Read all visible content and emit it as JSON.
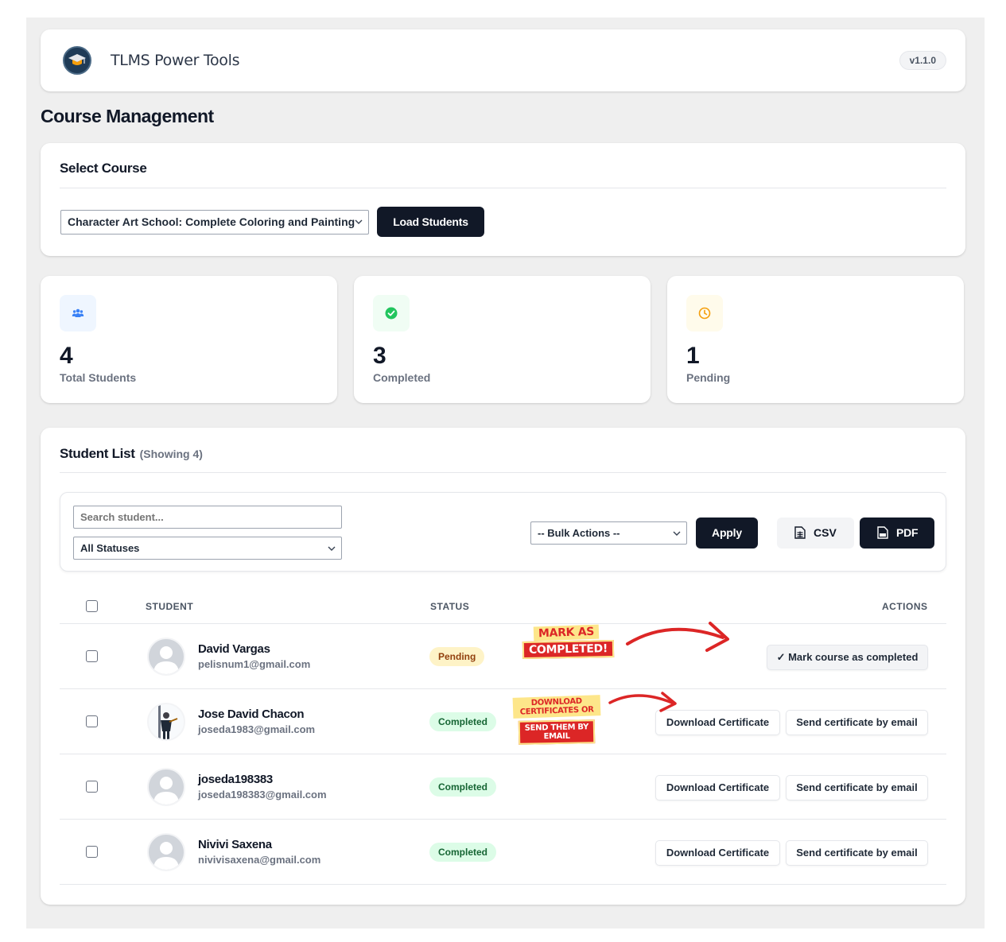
{
  "app": {
    "title": "TLMS Power Tools",
    "version": "v1.1.0"
  },
  "page": {
    "title": "Course Management"
  },
  "select_course": {
    "title": "Select Course",
    "selected_course": "Character Art School: Complete Coloring and Painting",
    "load_button": "Load Students"
  },
  "stats": [
    {
      "value": "4",
      "label": "Total Students",
      "icon": "users-icon",
      "color": "#3b82f6"
    },
    {
      "value": "3",
      "label": "Completed",
      "icon": "check-circle-icon",
      "color": "#22c55e"
    },
    {
      "value": "1",
      "label": "Pending",
      "icon": "clock-icon",
      "color": "#f59e0b"
    }
  ],
  "student_list": {
    "title": "Student List",
    "showing": "(Showing 4)",
    "search_placeholder": "Search student...",
    "status_filter": "All Statuses",
    "bulk_actions": "-- Bulk Actions --",
    "apply_button": "Apply",
    "csv_button": "CSV",
    "pdf_button": "PDF",
    "columns": {
      "student": "STUDENT",
      "status": "STATUS",
      "actions": "ACTIONS"
    },
    "rows": [
      {
        "name": "David Vargas",
        "email": "pelisnum1@gmail.com",
        "status": "Pending",
        "actions": [
          "✓ Mark course as completed"
        ]
      },
      {
        "name": "Jose David Chacon",
        "email": "joseda1983@gmail.com",
        "status": "Completed",
        "actions": [
          "Download Certificate",
          "Send certificate by email"
        ]
      },
      {
        "name": "joseda198383",
        "email": "joseda198383@gmail.com",
        "status": "Completed",
        "actions": [
          "Download Certificate",
          "Send certificate by email"
        ]
      },
      {
        "name": "Nivivi Saxena",
        "email": "nivivisaxena@gmail.com",
        "status": "Completed",
        "actions": [
          "Download Certificate",
          "Send certificate by email"
        ]
      }
    ]
  },
  "annotations": {
    "mark_line1": "MARK AS",
    "mark_line2": "COMPLETED!",
    "download_line1": "DOWNLOAD CERTIFICATES OR",
    "download_line2": "SEND THEM BY EMAIL"
  },
  "colors": {
    "primary": "#111827",
    "pending_bg": "#fef3c7",
    "completed_bg": "#dcfce7",
    "annotation_red": "#dc2626"
  }
}
